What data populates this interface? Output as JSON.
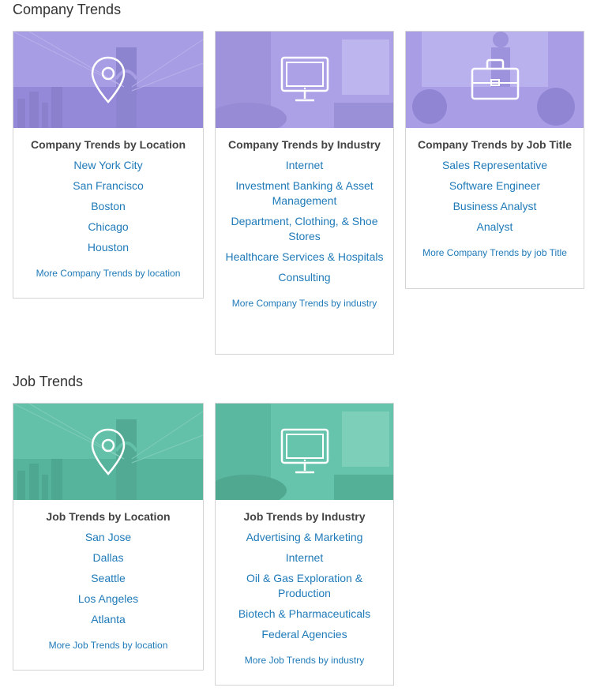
{
  "sections": {
    "company": {
      "title": "Company Trends",
      "cards": [
        {
          "title": "Company Trends by Location",
          "icon": "location-pin-icon",
          "links": [
            "New York City",
            "San Francisco",
            "Boston",
            "Chicago",
            "Houston"
          ],
          "more": "More Company Trends by location"
        },
        {
          "title": "Company Trends by Industry",
          "icon": "monitor-icon",
          "links": [
            "Internet",
            "Investment Banking & Asset Management",
            "Department, Clothing, & Shoe Stores",
            "Healthcare Services & Hospitals",
            "Consulting"
          ],
          "more": "More Company Trends by industry"
        },
        {
          "title": "Company Trends by Job Title",
          "icon": "briefcase-icon",
          "links": [
            "Sales Representative",
            "Software Engineer",
            "Business Analyst",
            "Analyst"
          ],
          "more": "More Company Trends by job Title"
        }
      ]
    },
    "job": {
      "title": "Job Trends",
      "cards": [
        {
          "title": "Job Trends by Location",
          "icon": "location-pin-icon",
          "links": [
            "San Jose",
            "Dallas",
            "Seattle",
            "Los Angeles",
            "Atlanta"
          ],
          "more": "More Job Trends by location"
        },
        {
          "title": "Job Trends by Industry",
          "icon": "monitor-icon",
          "links": [
            "Advertising & Marketing",
            "Internet",
            "Oil & Gas Exploration & Production",
            "Biotech & Pharmaceuticals",
            "Federal Agencies"
          ],
          "more": "More Job Trends by industry"
        }
      ]
    }
  },
  "colors": {
    "company_tint": "#9b8ce0",
    "job_tint": "#4fb8a0",
    "link": "#1f7ab8",
    "title": "#444444"
  }
}
